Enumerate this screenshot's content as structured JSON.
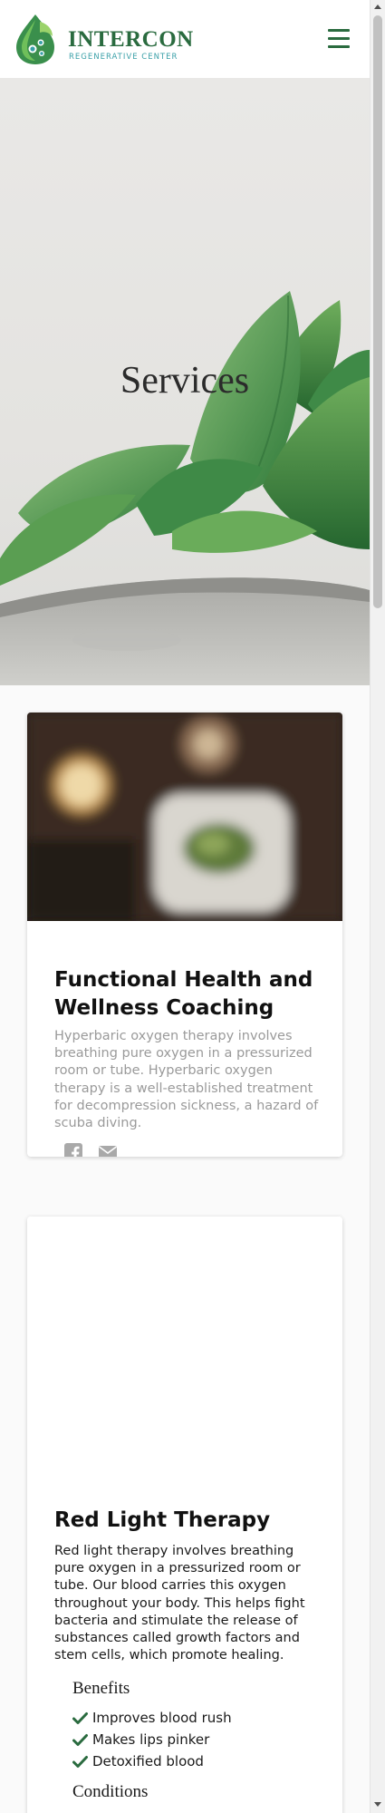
{
  "header": {
    "brand_name": "INTERCON",
    "brand_subtitle": "REGENERATIVE CENTER",
    "logo_icon": "leaf-drop-logo",
    "menu_icon": "hamburger-menu-icon"
  },
  "hero": {
    "title": "Services"
  },
  "services": [
    {
      "title": "Functional Health and Wellness Coaching",
      "description": "Hyperbaric oxygen therapy involves breathing pure oxygen in a pressurized room or tube. Hyperbaric oxygen therapy is a well-established treatment for decompression sickness, a hazard of scuba diving.",
      "share_icons": [
        "facebook-icon",
        "envelope-icon"
      ]
    },
    {
      "title": "Red Light Therapy",
      "description": "Red light therapy involves breathing pure oxygen in a pressurized room or tube. Our blood carries this oxygen throughout your body. This helps fight bacteria and stimulate the release of substances called growth factors and stem cells, which promote healing.",
      "benefits_heading": "Benefits",
      "benefits": [
        "Improves blood rush",
        "Makes lips pinker",
        "Detoxified blood"
      ],
      "conditions_heading": "Conditions"
    }
  ],
  "colors": {
    "brand_green": "#2a6b3f",
    "brand_teal": "#3aa0a8",
    "muted_text": "#9a9a9a",
    "page_bg": "#fafafa"
  }
}
